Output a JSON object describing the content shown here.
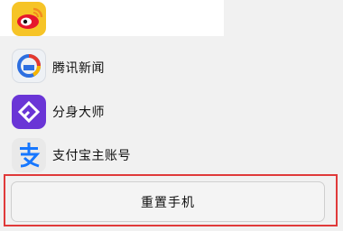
{
  "apps": [
    {
      "label": "",
      "icon": "weibo-icon"
    },
    {
      "label": "腾讯新闻",
      "icon": "tencent-news-icon"
    },
    {
      "label": "分身大师",
      "icon": "fenshen-dashi-icon"
    },
    {
      "label": "支付宝主账号",
      "icon": "alipay-icon"
    }
  ],
  "reset": {
    "label": "重置手机"
  },
  "colors": {
    "highlight": "#e03a3a",
    "weibo": "#f6c427",
    "fenshen": "#6a35d6"
  }
}
